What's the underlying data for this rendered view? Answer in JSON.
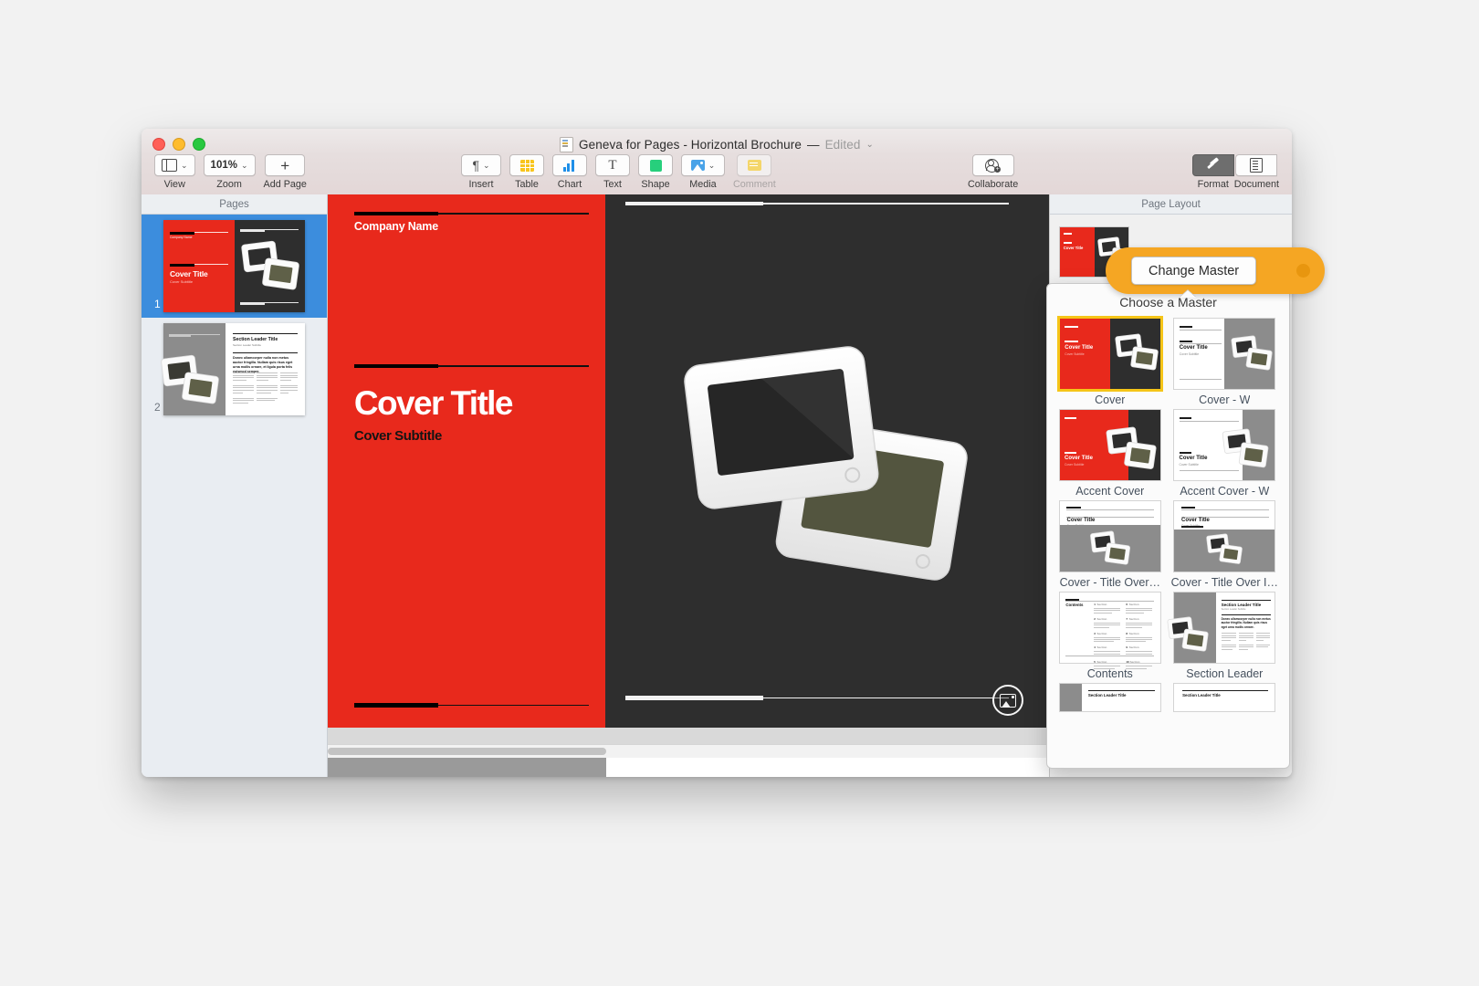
{
  "window": {
    "title": "Geneva for Pages - Horizontal Brochure",
    "title_separator": "—",
    "edited_label": "Edited",
    "title_chevron": "⌄"
  },
  "toolbar": {
    "left_items": [
      {
        "label": "View",
        "icon": "view-icon",
        "chevron": "⌄"
      },
      {
        "label": "Zoom",
        "icon": "zoom-value",
        "value": "101%",
        "chevron": "⌄"
      },
      {
        "label": "Add Page",
        "icon": "plus-icon"
      }
    ],
    "center_items": [
      {
        "label": "Insert",
        "icon": "pilcrow-icon",
        "glyph": "¶",
        "chevron": "⌄"
      },
      {
        "label": "Table",
        "icon": "table-icon"
      },
      {
        "label": "Chart",
        "icon": "chart-icon"
      },
      {
        "label": "Text",
        "icon": "text-icon",
        "glyph": "T"
      },
      {
        "label": "Shape",
        "icon": "shape-icon"
      },
      {
        "label": "Media",
        "icon": "media-icon",
        "chevron": "⌄"
      },
      {
        "label": "Comment",
        "icon": "comment-icon",
        "disabled": true
      }
    ],
    "right_items": [
      {
        "label": "Collaborate",
        "icon": "collaborate-icon"
      }
    ],
    "inspector_toggles": [
      {
        "label": "Format",
        "icon": "format-brush-icon",
        "active": true
      },
      {
        "label": "Document",
        "icon": "document-icon",
        "active": false
      }
    ]
  },
  "sidebar": {
    "header": "Pages",
    "pages": [
      {
        "number": "1",
        "selected": true,
        "kind": "cover",
        "title": "Cover Title",
        "subtitle": "Cover Subtitle",
        "company": "Company Name"
      },
      {
        "number": "2",
        "selected": false,
        "kind": "section-leader",
        "title": "Section Leader Title",
        "subtitle": "Section Leader Subtitle"
      }
    ]
  },
  "canvas": {
    "company_name": "Company Name",
    "cover_title": "Cover Title",
    "cover_subtitle": "Cover Subtitle",
    "media_placeholder_icon": "image-placeholder-icon",
    "page_background_left": "#e8291c",
    "page_background_right": "#2e2e2e"
  },
  "inspector": {
    "header": "Page Layout",
    "current_master_name": "Cover",
    "change_master_button": "Change Master"
  },
  "popover": {
    "title": "Choose a Master",
    "masters": [
      {
        "label": "Cover",
        "selected": true,
        "style": "red-dark"
      },
      {
        "label": "Cover - W",
        "selected": false,
        "style": "white-gray"
      },
      {
        "label": "Accent Cover",
        "selected": false,
        "style": "red-dark-accent"
      },
      {
        "label": "Accent Cover - W",
        "selected": false,
        "style": "white-gray-accent"
      },
      {
        "label": "Cover - Title Over…",
        "selected": false,
        "style": "title-over"
      },
      {
        "label": "Cover - Title Over I…",
        "selected": false,
        "style": "title-over-2"
      },
      {
        "label": "Contents",
        "selected": false,
        "style": "contents"
      },
      {
        "label": "Section Leader",
        "selected": false,
        "style": "section-leader"
      }
    ]
  },
  "colors": {
    "accent_red": "#e8291c",
    "dark_panel": "#2e2e2e",
    "callout_orange": "#f5a623",
    "selection_blue": "#3c8ddd",
    "selection_gold": "#f5c518"
  }
}
